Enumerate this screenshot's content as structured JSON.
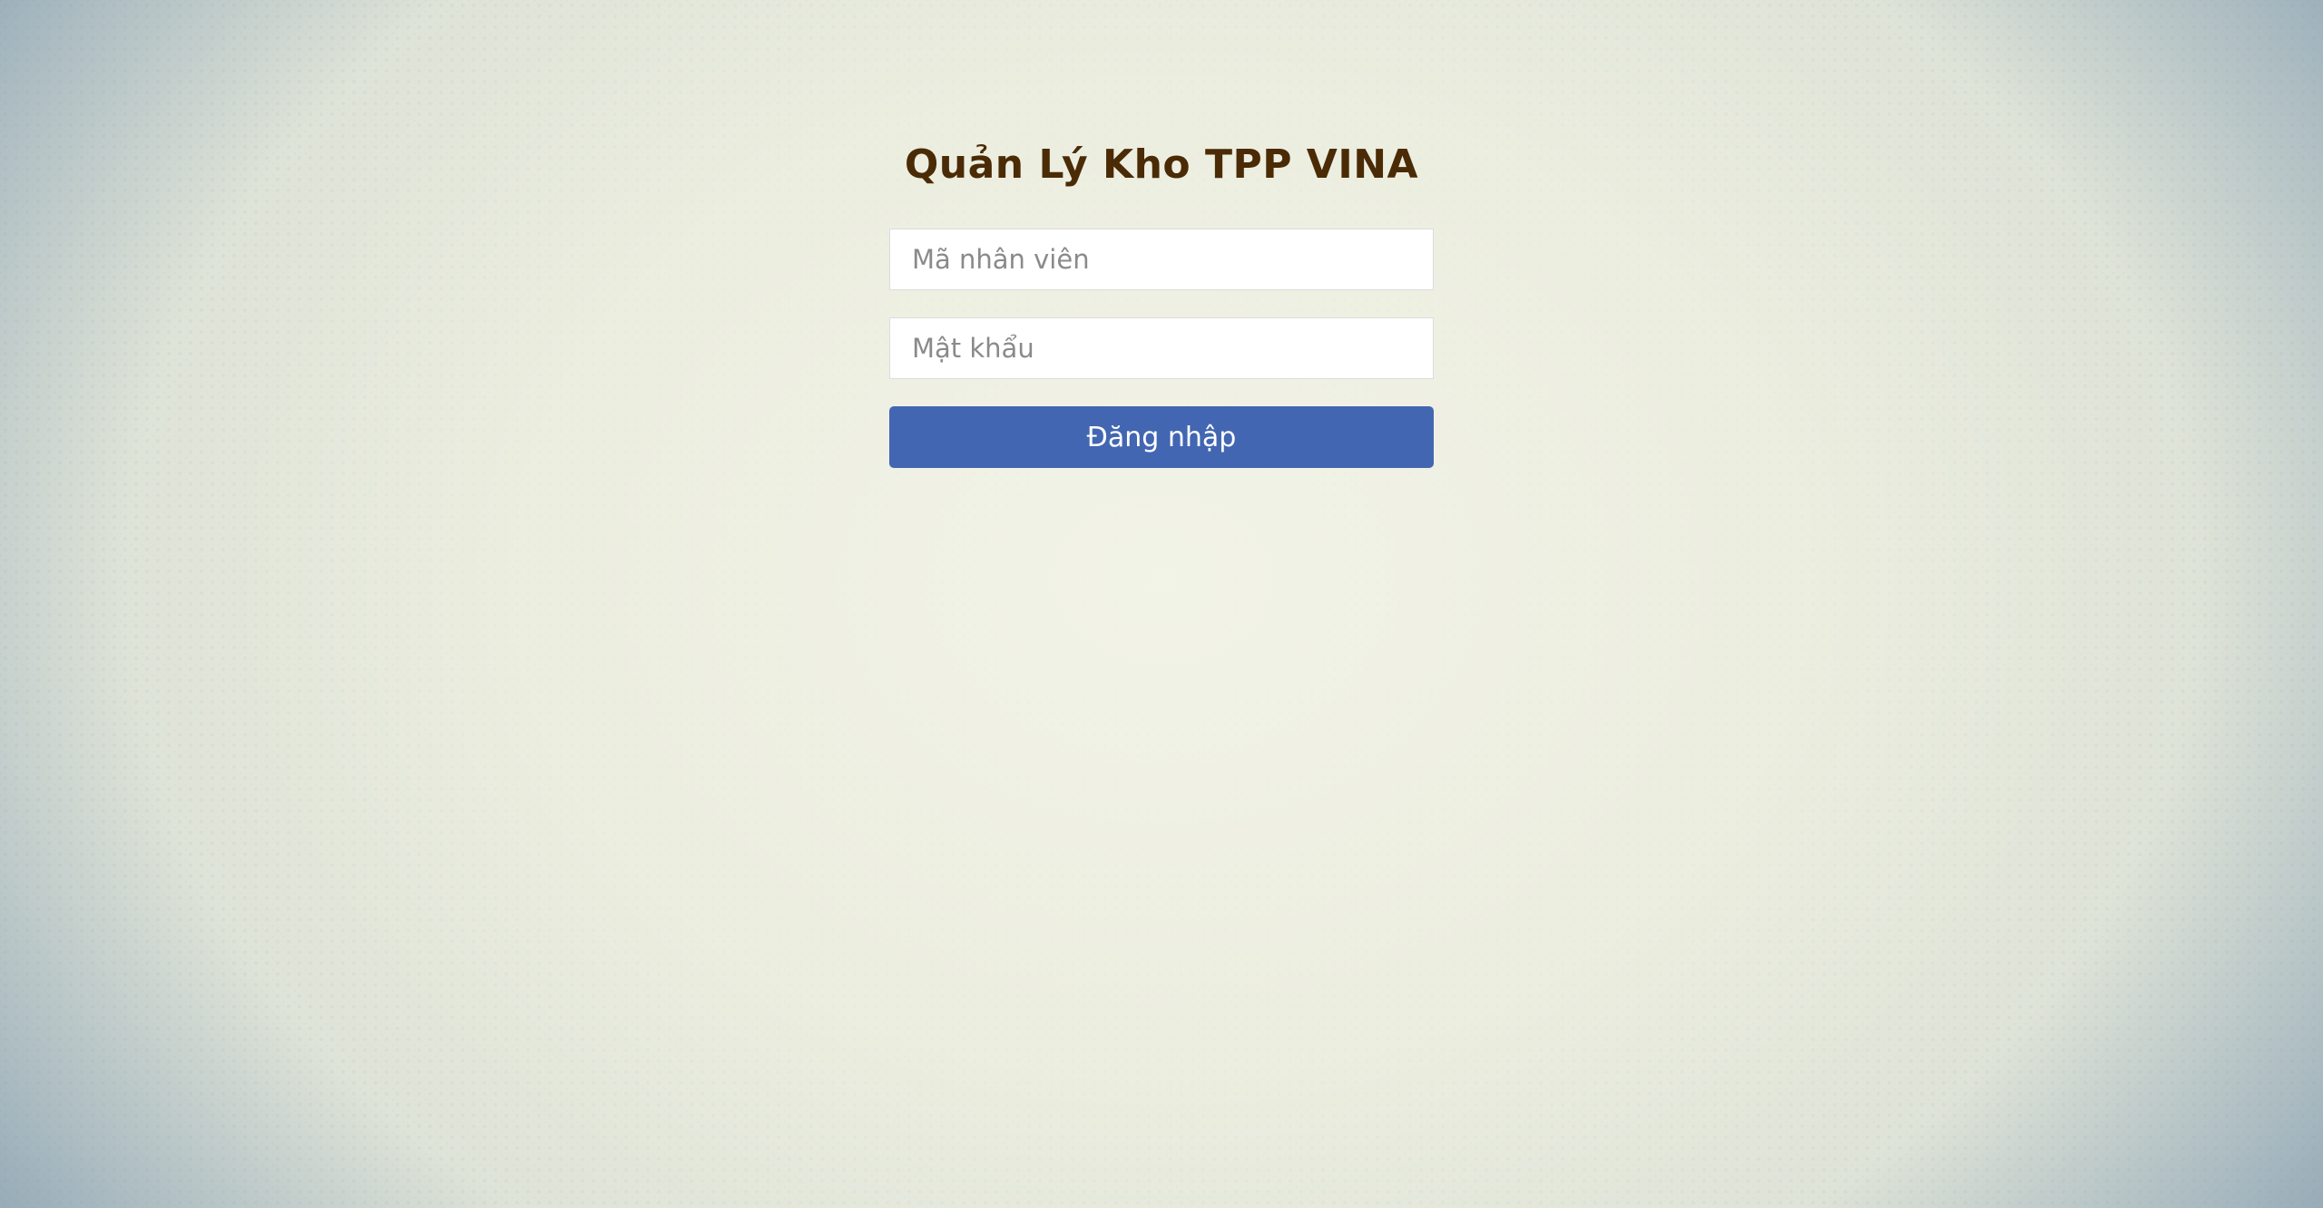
{
  "page": {
    "title": "Quản Lý Kho TPP VINA"
  },
  "form": {
    "employee_id_placeholder": "Mã nhân viên",
    "employee_id_value": "",
    "password_placeholder": "Mật khẩu",
    "password_value": "",
    "submit_label": "Đăng nhập"
  },
  "colors": {
    "title": "#4a2b06",
    "button_bg": "#4266b2",
    "button_text": "#ffffff",
    "background": "#e9ebdc"
  }
}
